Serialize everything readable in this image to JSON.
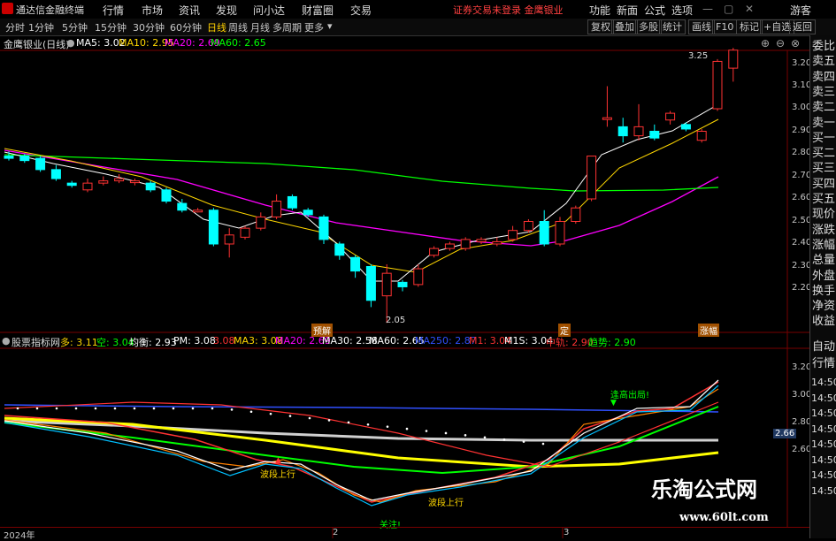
{
  "menubar": {
    "app_title": "通达信金融终端",
    "items": [
      "行情",
      "市场",
      "资讯",
      "发现",
      "问小达",
      "财富圈",
      "交易"
    ],
    "notice": "证券交易未登录   金鹰银业",
    "right_items": [
      "功能",
      "新面",
      "公式",
      "选项"
    ],
    "guest": "游客"
  },
  "toolbar": {
    "timeframes": [
      "分时",
      "1分钟",
      "5分钟",
      "15分钟",
      "30分钟",
      "60分钟",
      "日线",
      "周线",
      "月线",
      "多周期",
      "更多"
    ],
    "active_timeframe": "日线",
    "buttons": [
      "复权",
      "叠加",
      "多股",
      "统计",
      "画线",
      "F10",
      "标记",
      "+自选",
      "返回"
    ]
  },
  "price_info": {
    "stock_name": "金鹰银业(日线)",
    "ma5": "MA5: 3.02",
    "ma10": "MA10: 2.95",
    "ma20": "MA20: 2.69",
    "ma60": "MA60: 2.65"
  },
  "price_axis": [
    "3.20",
    "3.10",
    "3.00",
    "2.90",
    "2.80",
    "2.70",
    "2.60",
    "2.50",
    "2.40",
    "2.30",
    "2.20"
  ],
  "price_annotations": {
    "high_label": "3.25",
    "low_label": "2.05"
  },
  "event_tags": [
    "预解",
    "定",
    "涨幅"
  ],
  "indicator_info": {
    "name": "股票指标网",
    "duo": "多: 3.11",
    "kong": "空: 3.04",
    "junheng": "均衡: 2.93",
    "pm": "PM: 3.08",
    "v1": "3.08",
    "ma3": "MA3: 3.08",
    "ma20": "MA20: 2.69",
    "ma30": "MA30: 2.58",
    "ma60": "MA60: 2.65",
    "ma250": "MA250: 2.87",
    "m1": "M1: 3.04",
    "m1s": "M1S: 3.04",
    "zhonggui": "中轨: 2.90",
    "qushi": "趋势: 2.90"
  },
  "indicator_axis": [
    "3.20",
    "3.00",
    "2.80",
    "2.60"
  ],
  "indicator_current": "2.66",
  "indicator_annotations": {
    "breakout": "逢高出局!",
    "wave_up_1": "波段上行",
    "wave_up_2": "波段上行",
    "attention": "关注!"
  },
  "right_panel": {
    "top_items": [
      "委比",
      "卖五",
      "卖四",
      "卖三",
      "卖二",
      "卖一",
      "买一",
      "买二",
      "买三",
      "买四",
      "买五",
      "现价",
      "涨跌",
      "涨幅",
      "总量",
      "外盘",
      "换手",
      "净资",
      "收益"
    ],
    "bottom_items": [
      "自动",
      "行情"
    ],
    "times": [
      "14:50",
      "14:50",
      "14:50",
      "14:50",
      "14:50",
      "14:50",
      "14:50",
      "14:50"
    ]
  },
  "bottombar": {
    "year": "2024年",
    "m2": "2",
    "m3": "3"
  },
  "watermark": {
    "title": "乐淘公式网",
    "url": "www.60lt.com"
  },
  "colors": {
    "up": "#ff3232",
    "down": "#00ffff",
    "ma5": "#ffffff",
    "ma10": "#ffd700",
    "ma20": "#ff00ff",
    "ma60": "#00ff00"
  }
}
